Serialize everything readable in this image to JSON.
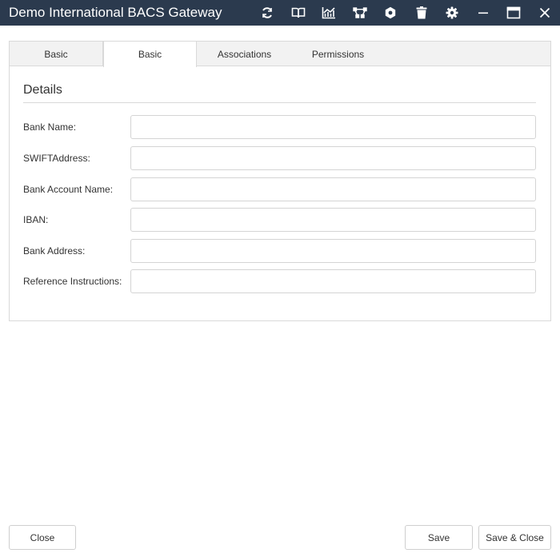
{
  "window": {
    "title": "Demo International BACS Gateway",
    "icons": [
      "refresh-icon",
      "book-icon",
      "chart-icon",
      "workflow-icon",
      "hexagon-gear-icon",
      "trash-icon",
      "settings-icon",
      "minimize-icon",
      "maximize-icon",
      "close-icon"
    ]
  },
  "tabs": [
    {
      "label": "Basic",
      "active": false
    },
    {
      "label": "Basic",
      "active": true
    },
    {
      "label": "Associations",
      "active": false
    },
    {
      "label": "Permissions",
      "active": false
    }
  ],
  "section": {
    "title": "Details"
  },
  "form": {
    "fields": [
      {
        "label": "Bank Name:",
        "value": "",
        "placeholder": ""
      },
      {
        "label": "SWIFTAddress:",
        "value": "",
        "placeholder": ""
      },
      {
        "label": "Bank Account Name:",
        "value": "",
        "placeholder": ""
      },
      {
        "label": "IBAN:",
        "value": "",
        "placeholder": ""
      },
      {
        "label": "Bank Address:",
        "value": "",
        "placeholder": ""
      },
      {
        "label": "Reference Instructions:",
        "value": "",
        "placeholder": ""
      }
    ]
  },
  "footer": {
    "close_label": "Close",
    "save_label": "Save",
    "save_close_label": "Save & Close"
  },
  "colors": {
    "titlebar": "#2b3a4e",
    "tab_strip": "#f2f2f2",
    "border": "#d9d9d9"
  }
}
